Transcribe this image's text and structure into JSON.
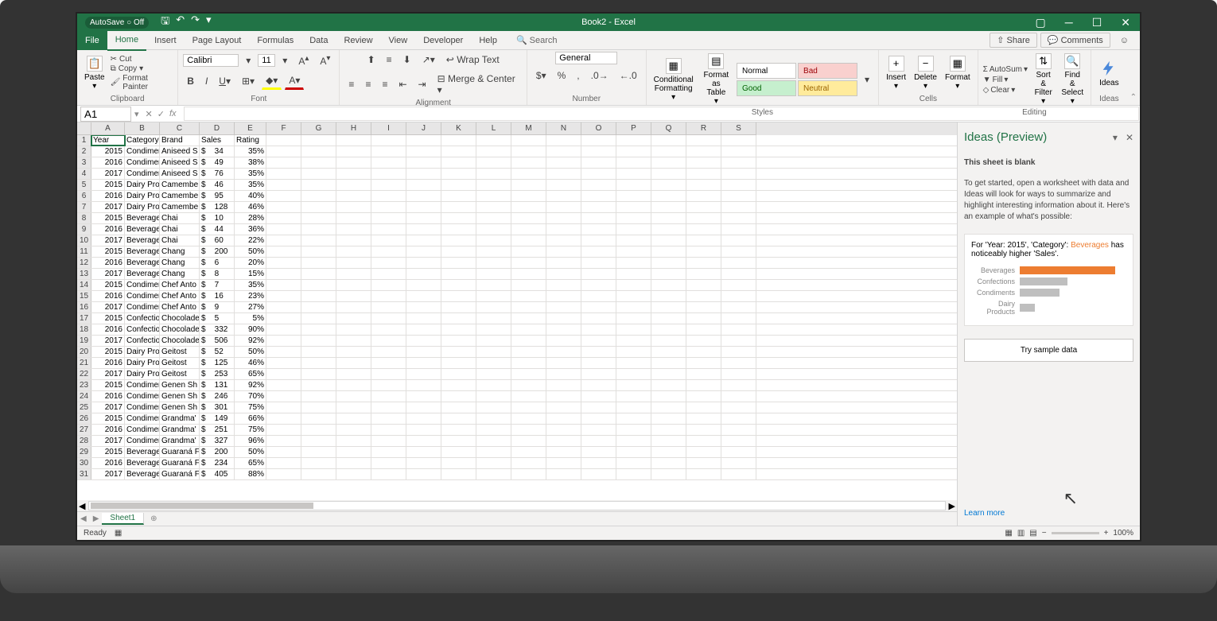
{
  "window": {
    "autosave": "AutoSave ○ Off",
    "title": "Book2 - Excel"
  },
  "ribbon_tabs": [
    "File",
    "Home",
    "Insert",
    "Page Layout",
    "Formulas",
    "Data",
    "Review",
    "View",
    "Developer",
    "Help"
  ],
  "search_placeholder": "Search",
  "share_label": "Share",
  "comments_label": "Comments",
  "clipboard": {
    "cut": "Cut",
    "copy": "Copy",
    "painter": "Format Painter",
    "label": "Clipboard"
  },
  "font": {
    "name": "Calibri",
    "size": "11",
    "label": "Font"
  },
  "alignment": {
    "wrap": "Wrap Text",
    "merge": "Merge & Center",
    "label": "Alignment"
  },
  "number": {
    "format": "General",
    "label": "Number"
  },
  "styles": {
    "cond": "Conditional\nFormatting",
    "table": "Format as\nTable",
    "normal": "Normal",
    "bad": "Bad",
    "good": "Good",
    "neutral": "Neutral",
    "label": "Styles"
  },
  "cells": {
    "insert": "Insert",
    "delete": "Delete",
    "format": "Format",
    "label": "Cells"
  },
  "editing": {
    "autosum": "AutoSum",
    "fill": "Fill",
    "clear": "Clear",
    "sort": "Sort &\nFilter",
    "find": "Find &\nSelect",
    "label": "Editing"
  },
  "ideas": {
    "button": "Ideas",
    "label": "Ideas"
  },
  "namebox": "A1",
  "columns": [
    "A",
    "B",
    "C",
    "D",
    "E",
    "F",
    "G",
    "H",
    "I",
    "J",
    "K",
    "L",
    "M",
    "N",
    "O",
    "P",
    "Q",
    "R",
    "S"
  ],
  "headers": [
    "Year",
    "Category",
    "Brand",
    "Sales",
    "Rating"
  ],
  "rows": [
    [
      2015,
      "Condimer",
      "Aniseed S",
      "$",
      "34",
      "35%"
    ],
    [
      2016,
      "Condimer",
      "Aniseed S",
      "$",
      "49",
      "38%"
    ],
    [
      2017,
      "Condimer",
      "Aniseed S",
      "$",
      "76",
      "35%"
    ],
    [
      2015,
      "Dairy Proc",
      "Camembe",
      "$",
      "46",
      "35%"
    ],
    [
      2016,
      "Dairy Proc",
      "Camembe",
      "$",
      "95",
      "40%"
    ],
    [
      2017,
      "Dairy Proc",
      "Camembe",
      "$",
      "128",
      "46%"
    ],
    [
      2015,
      "Beverage",
      "Chai",
      "$",
      "10",
      "28%"
    ],
    [
      2016,
      "Beverage",
      "Chai",
      "$",
      "44",
      "36%"
    ],
    [
      2017,
      "Beverage",
      "Chai",
      "$",
      "60",
      "22%"
    ],
    [
      2015,
      "Beverage",
      "Chang",
      "$",
      "200",
      "50%"
    ],
    [
      2016,
      "Beverage",
      "Chang",
      "$",
      "6",
      "20%"
    ],
    [
      2017,
      "Beverage",
      "Chang",
      "$",
      "8",
      "15%"
    ],
    [
      2015,
      "Condimer",
      "Chef Anto",
      "$",
      "7",
      "35%"
    ],
    [
      2016,
      "Condimer",
      "Chef Anto",
      "$",
      "16",
      "23%"
    ],
    [
      2017,
      "Condimer",
      "Chef Anto",
      "$",
      "9",
      "27%"
    ],
    [
      2015,
      "Confectio",
      "Chocolade",
      "$",
      "5",
      "5%"
    ],
    [
      2016,
      "Confectio",
      "Chocolade",
      "$",
      "332",
      "90%"
    ],
    [
      2017,
      "Confectio",
      "Chocolade",
      "$",
      "506",
      "92%"
    ],
    [
      2015,
      "Dairy Proc",
      "Geitost",
      "$",
      "52",
      "50%"
    ],
    [
      2016,
      "Dairy Proc",
      "Geitost",
      "$",
      "125",
      "46%"
    ],
    [
      2017,
      "Dairy Proc",
      "Geitost",
      "$",
      "253",
      "65%"
    ],
    [
      2015,
      "Condimer",
      "Genen Sh",
      "$",
      "131",
      "92%"
    ],
    [
      2016,
      "Condimer",
      "Genen Sh",
      "$",
      "246",
      "70%"
    ],
    [
      2017,
      "Condimer",
      "Genen Sh",
      "$",
      "301",
      "75%"
    ],
    [
      2015,
      "Condimer",
      "Grandma'",
      "$",
      "149",
      "66%"
    ],
    [
      2016,
      "Condimer",
      "Grandma'",
      "$",
      "251",
      "75%"
    ],
    [
      2017,
      "Condimer",
      "Grandma'",
      "$",
      "327",
      "96%"
    ],
    [
      2015,
      "Beverage",
      "Guaraná F",
      "$",
      "200",
      "50%"
    ],
    [
      2016,
      "Beverage",
      "Guaraná F",
      "$",
      "234",
      "65%"
    ],
    [
      2017,
      "Beverage",
      "Guaraná F",
      "$",
      "405",
      "88%"
    ]
  ],
  "sheet_tab": "Sheet1",
  "status": {
    "ready": "Ready",
    "zoom": "100%"
  },
  "pane": {
    "title": "Ideas (Preview)",
    "blank": "This sheet is blank",
    "desc": "To get started, open a worksheet with data and Ideas will look for ways to summarize and highlight interesting information about it. Here's an example of what's possible:",
    "insight_pre": "For 'Year: 2015', 'Category': ",
    "insight_hl": "Beverages",
    "insight_post": " has noticeably higher 'Sales'.",
    "try": "Try sample data",
    "learn": "Learn more"
  },
  "chart_data": {
    "type": "bar",
    "orientation": "horizontal",
    "categories": [
      "Beverages",
      "Confections",
      "Condiments",
      "Dairy Products"
    ],
    "values": [
      100,
      50,
      42,
      16
    ],
    "highlight_index": 0,
    "title": "",
    "xlabel": "",
    "ylabel": ""
  }
}
